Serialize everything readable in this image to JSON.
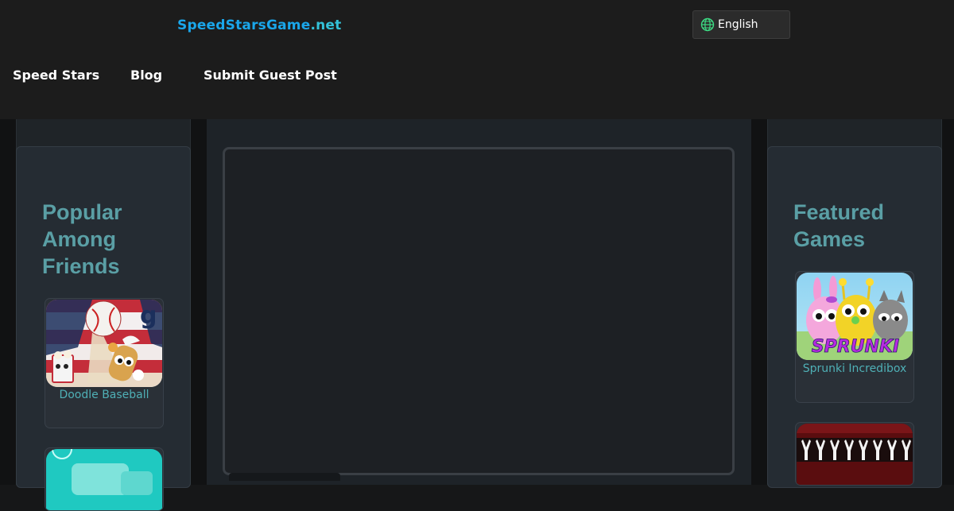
{
  "header": {
    "logo_main": "SpeedStarsGame",
    "logo_tld": ".net",
    "language": "English",
    "icon": "globe-icon"
  },
  "nav": {
    "items": [
      {
        "label": "Speed Stars"
      },
      {
        "label": "Blog"
      },
      {
        "label": "Submit Guest Post"
      }
    ]
  },
  "left_sidebar": {
    "title": "Popular Among Friends",
    "games": [
      {
        "name": "Doodle Baseball"
      },
      {
        "name": ""
      }
    ]
  },
  "right_sidebar": {
    "title": "Featured Games",
    "games": [
      {
        "name": "Sprunki Incredibox",
        "thumb_text": "SPRUNKI"
      },
      {
        "name": ""
      }
    ]
  },
  "colors": {
    "header_bg": "#1c1c1c",
    "logo_blue": "#1aa6ea",
    "sidebar_title": "#5a9fa5",
    "game_name": "#4fb0b6"
  }
}
